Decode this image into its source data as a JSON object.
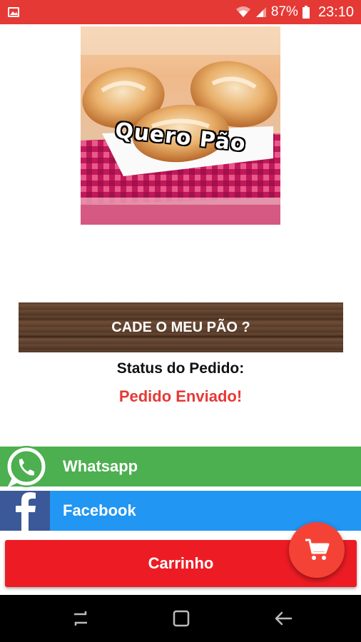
{
  "status_bar": {
    "battery_percent": "87%",
    "time": "23:10",
    "color": "#e53935"
  },
  "banner": {
    "title": "Quero Pão"
  },
  "header": {
    "label": "CADE O MEU PÃO ?"
  },
  "order": {
    "status_title": "Status do Pedido:",
    "status_value": "Pedido Enviado!",
    "status_color": "#e53935"
  },
  "share": {
    "whatsapp_label": "Whatsapp",
    "whatsapp_color": "#4caf50",
    "facebook_label": "Facebook",
    "facebook_color": "#2196f3"
  },
  "cart": {
    "button_label": "Carrinho",
    "button_color": "#ed1c24",
    "fab_icon": "cart-icon"
  },
  "nav": {
    "icons": [
      "recent-apps-icon",
      "home-icon",
      "back-icon"
    ]
  }
}
